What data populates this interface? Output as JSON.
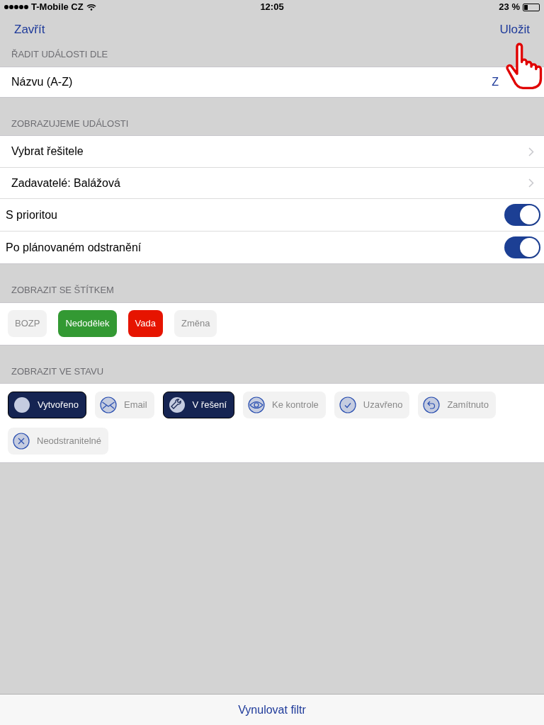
{
  "status_bar": {
    "carrier": "T-Mobile CZ",
    "time": "12:05",
    "battery": "23 %"
  },
  "nav": {
    "left": "Zavřít",
    "right": "Uložit"
  },
  "sort": {
    "header": "ŘADIT UDÁLOSTI DLE",
    "label": "Názvu (A-Z)",
    "value": "Z"
  },
  "filters": {
    "header": "ZOBRAZUJEME UDÁLOSTI",
    "rows": [
      {
        "kind": "link",
        "label": "Vybrat řešitele"
      },
      {
        "kind": "link",
        "label": "Zadavatelé: Balážová"
      },
      {
        "kind": "toggle",
        "label": "S prioritou",
        "on": true
      },
      {
        "kind": "toggle",
        "label": "Po plánovaném odstranění",
        "on": true
      }
    ]
  },
  "tags": {
    "header": "ZOBRAZIT SE ŠTÍTKEM",
    "items": [
      {
        "label": "BOZP",
        "selected": false,
        "color": "#f2f2f2"
      },
      {
        "label": "Nedodělek",
        "selected": true,
        "color": "#339933"
      },
      {
        "label": "Vada",
        "selected": true,
        "color": "#e61400"
      },
      {
        "label": "Změna",
        "selected": false,
        "color": "#f2f2f2"
      }
    ]
  },
  "states": {
    "header": "ZOBRAZIT VE STAVU",
    "items": [
      {
        "label": "Vytvořeno",
        "kind": "dot",
        "selected": true
      },
      {
        "label": "Email",
        "kind": "mail",
        "selected": false
      },
      {
        "label": "V řešení",
        "kind": "wrench",
        "selected": true
      },
      {
        "label": "Ke kontrole",
        "kind": "eye",
        "selected": false
      },
      {
        "label": "Uzavřeno",
        "kind": "check",
        "selected": false
      },
      {
        "label": "Zamítnuto",
        "kind": "undo",
        "selected": false
      },
      {
        "label": "Neodstranitelné",
        "kind": "cross",
        "selected": false
      }
    ]
  },
  "footer": {
    "button": "Vynulovat filtr"
  }
}
